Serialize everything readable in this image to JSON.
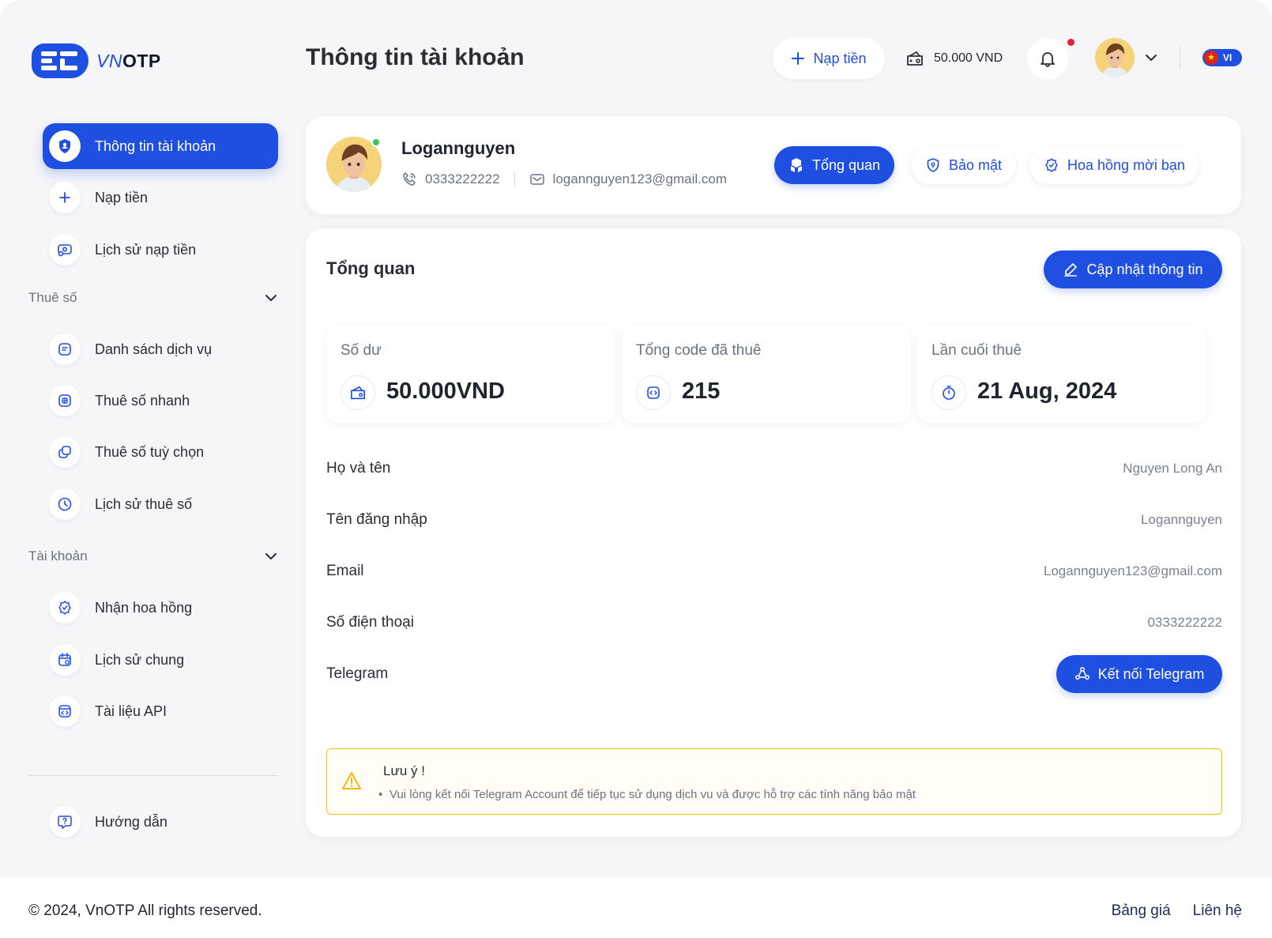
{
  "brand": {
    "logo_vn": "VN",
    "logo_otp": "OTP"
  },
  "header": {
    "page_title": "Thông tin tài khoản",
    "topup_label": "Nạp tiền",
    "balance": "50.000 VND",
    "language": "VI"
  },
  "sidebar": {
    "items_top": [
      {
        "label": "Thông tin tài khoản",
        "icon": "user-shield-icon",
        "active": true
      },
      {
        "label": "Nạp tiền",
        "icon": "plus-icon"
      },
      {
        "label": "Lịch sử nạp tiền",
        "icon": "money-history-icon"
      }
    ],
    "section_rent": {
      "title": "Thuê số",
      "items": [
        {
          "label": "Danh sách dịch vụ",
          "icon": "list-icon"
        },
        {
          "label": "Thuê số nhanh",
          "icon": "sim-icon"
        },
        {
          "label": "Thuê số tuỳ chọn",
          "icon": "copy-icon"
        },
        {
          "label": "Lịch sử thuê số",
          "icon": "clock-icon"
        }
      ]
    },
    "section_account": {
      "title": "Tài khoản",
      "items": [
        {
          "label": "Nhận hoa hồng",
          "icon": "badge-icon"
        },
        {
          "label": "Lịch sử chung",
          "icon": "calendar-icon"
        },
        {
          "label": "Tài liệu API",
          "icon": "api-icon"
        }
      ]
    },
    "guide_label": "Hướng dẫn"
  },
  "profile": {
    "name": "Logannguyen",
    "phone": "0333222222",
    "email": "logannguyen123@gmail.com",
    "tabs": [
      {
        "label": "Tổng quan",
        "icon": "boxes-icon",
        "active": true
      },
      {
        "label": "Bảo mật",
        "icon": "shield-icon"
      },
      {
        "label": "Hoa hồng mời bạn",
        "icon": "badge-icon"
      }
    ]
  },
  "overview": {
    "title": "Tổng quan",
    "update_label": "Cập nhật thông tin",
    "stats": [
      {
        "label": "Số dư",
        "value": "50.000VND",
        "icon": "wallet-icon"
      },
      {
        "label": "Tổng code đã thuê",
        "value": "215",
        "icon": "code-icon"
      },
      {
        "label": "Lần cuối thuê",
        "value": "21 Aug, 2024",
        "icon": "timer-icon"
      }
    ],
    "fields": [
      {
        "key": "Họ và tên",
        "value": "Nguyen Long An"
      },
      {
        "key": "Tên đăng nhập",
        "value": "Logannguyen"
      },
      {
        "key": "Email",
        "value": "Logannguyen123@gmail.com"
      },
      {
        "key": "Số điện thoại",
        "value": "0333222222"
      }
    ],
    "telegram_key": "Telegram",
    "telegram_button": "Kết nối Telegram",
    "note_title": "Lưu ý !",
    "note_text": "Vui lòng kết nối Telegram Account để tiếp tục sử dụng dịch vu và được hỗ trợ các tính năng bảo mật"
  },
  "footer": {
    "copyright": "© 2024, VnOTP All rights reserved.",
    "links": [
      "Bảng giá",
      "Liên hệ"
    ]
  },
  "colors": {
    "primary": "#1f4fe0",
    "background": "#f6f6f8",
    "warning": "#f5c211",
    "online": "#35c759"
  }
}
